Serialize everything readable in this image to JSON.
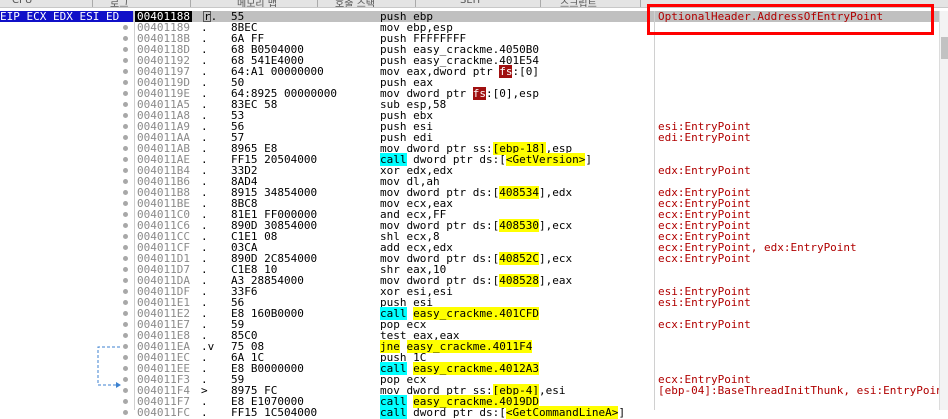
{
  "top_tabs": [
    "CPU",
    "로그",
    "메모리 맵",
    "호출 스택",
    "SEH",
    "스크립트"
  ],
  "reg_header": "EIP ECX EDX ESI ED",
  "rows": [
    {
      "addr": "00401188",
      "mark": "r.",
      "hex": "55",
      "pre": "push ebp",
      "hl": "",
      "post": "",
      "cmt": "OptionalHeader.AddressOfEntryPoint",
      "sel": true
    },
    {
      "addr": "00401189",
      "mark": ".",
      "hex": "8BEC",
      "pre": "mov ebp,esp",
      "hl": "",
      "post": "",
      "cmt": ""
    },
    {
      "addr": "0040118B",
      "mark": ".",
      "hex": "6A FF",
      "pre": "push FFFFFFFF",
      "hl": "",
      "post": "",
      "cmt": ""
    },
    {
      "addr": "0040118D",
      "mark": ".",
      "hex": "68 B0504000",
      "pre": "push easy_crackme.4050B0",
      "hl": "",
      "post": "",
      "cmt": ""
    },
    {
      "addr": "00401192",
      "mark": ".",
      "hex": "68 541E4000",
      "pre": "push easy_crackme.401E54",
      "hl": "",
      "post": "",
      "cmt": ""
    },
    {
      "addr": "00401197",
      "mark": ".",
      "hex": "64:A1 00000000",
      "pre": "mov eax,dword ptr ",
      "hl": "fs",
      "hlc": "r",
      "post": ":[0]",
      "cmt": ""
    },
    {
      "addr": "0040119D",
      "mark": ".",
      "hex": "50",
      "pre": "push eax",
      "hl": "",
      "post": "",
      "cmt": ""
    },
    {
      "addr": "0040119E",
      "mark": ".",
      "hex": "64:8925 00000000",
      "pre": "mov dword ptr ",
      "hl": "fs",
      "hlc": "r",
      "post": ":[0],esp",
      "cmt": ""
    },
    {
      "addr": "004011A5",
      "mark": ".",
      "hex": "83EC 58",
      "pre": "sub esp,58",
      "hl": "",
      "post": "",
      "cmt": ""
    },
    {
      "addr": "004011A8",
      "mark": ".",
      "hex": "53",
      "pre": "push ebx",
      "hl": "",
      "post": "",
      "cmt": ""
    },
    {
      "addr": "004011A9",
      "mark": ".",
      "hex": "56",
      "pre": "push esi",
      "hl": "",
      "post": "",
      "cmt": "esi:EntryPoint"
    },
    {
      "addr": "004011AA",
      "mark": ".",
      "hex": "57",
      "pre": "push edi",
      "hl": "",
      "post": "",
      "cmt": "edi:EntryPoint"
    },
    {
      "addr": "004011AB",
      "mark": ".",
      "hex": "8965 E8",
      "pre": "mov dword ptr ss:",
      "hl": "[ebp-18]",
      "hlc": "y",
      "post": ",esp",
      "cmt": ""
    },
    {
      "addr": "004011AE",
      "mark": ".",
      "hex": "FF15 20504000",
      "pre": "",
      "hl": "call",
      "hlc": "c",
      "post": " dword ptr ds:[<GetVersion>]",
      "post_hl": "<GetVersion>",
      "cmt": ""
    },
    {
      "addr": "004011B4",
      "mark": ".",
      "hex": "33D2",
      "pre": "xor edx,edx",
      "hl": "",
      "post": "",
      "cmt": "edx:EntryPoint"
    },
    {
      "addr": "004011B6",
      "mark": ".",
      "hex": "8AD4",
      "pre": "mov dl,ah",
      "hl": "",
      "post": "",
      "cmt": ""
    },
    {
      "addr": "004011B8",
      "mark": ".",
      "hex": "8915 34854000",
      "pre": "mov dword ptr ds:[",
      "hl": "408534",
      "hlc": "y",
      "post": "],edx",
      "cmt": "edx:EntryPoint"
    },
    {
      "addr": "004011BE",
      "mark": ".",
      "hex": "8BC8",
      "pre": "mov ecx,eax",
      "hl": "",
      "post": "",
      "cmt": "ecx:EntryPoint"
    },
    {
      "addr": "004011C0",
      "mark": ".",
      "hex": "81E1 FF000000",
      "pre": "and ecx,FF",
      "hl": "",
      "post": "",
      "cmt": "ecx:EntryPoint"
    },
    {
      "addr": "004011C6",
      "mark": ".",
      "hex": "890D 30854000",
      "pre": "mov dword ptr ds:[",
      "hl": "408530",
      "hlc": "y",
      "post": "],ecx",
      "cmt": "ecx:EntryPoint"
    },
    {
      "addr": "004011CC",
      "mark": ".",
      "hex": "C1E1 08",
      "pre": "shl ecx,8",
      "hl": "",
      "post": "",
      "cmt": "ecx:EntryPoint"
    },
    {
      "addr": "004011CF",
      "mark": ".",
      "hex": "03CA",
      "pre": "add ecx,edx",
      "hl": "",
      "post": "",
      "cmt": "ecx:EntryPoint, edx:EntryPoint"
    },
    {
      "addr": "004011D1",
      "mark": ".",
      "hex": "890D 2C854000",
      "pre": "mov dword ptr ds:[",
      "hl": "40852C",
      "hlc": "y",
      "post": "],ecx",
      "cmt": "ecx:EntryPoint"
    },
    {
      "addr": "004011D7",
      "mark": ".",
      "hex": "C1E8 10",
      "pre": "shr eax,10",
      "hl": "",
      "post": "",
      "cmt": ""
    },
    {
      "addr": "004011DA",
      "mark": ".",
      "hex": "A3 28854000",
      "pre": "mov dword ptr ds:[",
      "hl": "408528",
      "hlc": "y",
      "post": "],eax",
      "cmt": ""
    },
    {
      "addr": "004011DF",
      "mark": ".",
      "hex": "33F6",
      "pre": "xor esi,esi",
      "hl": "",
      "post": "",
      "cmt": "esi:EntryPoint"
    },
    {
      "addr": "004011E1",
      "mark": ".",
      "hex": "56",
      "pre": "push esi",
      "hl": "",
      "post": "",
      "cmt": "esi:EntryPoint"
    },
    {
      "addr": "004011E2",
      "mark": ".",
      "hex": "E8 160B0000",
      "pre": "",
      "hl": "call",
      "hlc": "c",
      "post": " easy_crackme.401CFD",
      "post_hl": "easy_crackme.401CFD",
      "cmt": ""
    },
    {
      "addr": "004011E7",
      "mark": ".",
      "hex": "59",
      "pre": "pop ecx",
      "hl": "",
      "post": "",
      "cmt": "ecx:EntryPoint"
    },
    {
      "addr": "004011E8",
      "mark": ".",
      "hex": "85C0",
      "pre": "test eax,eax",
      "hl": "",
      "post": "",
      "cmt": ""
    },
    {
      "addr": "004011EA",
      "mark": ".v",
      "hex": "75 08",
      "pre": "",
      "hl": "jne",
      "hlc": "y",
      "post": " easy_crackme.4011F4",
      "post_hl": "easy_crackme.4011F4",
      "cmt": ""
    },
    {
      "addr": "004011EC",
      "mark": ".",
      "hex": "6A 1C",
      "pre": "push 1C",
      "hl": "",
      "post": "",
      "cmt": ""
    },
    {
      "addr": "004011EE",
      "mark": ".",
      "hex": "E8 B0000000",
      "pre": "",
      "hl": "call",
      "hlc": "c",
      "post": " easy_crackme.4012A3",
      "post_hl": "easy_crackme.4012A3",
      "cmt": ""
    },
    {
      "addr": "004011F3",
      "mark": ".",
      "hex": "59",
      "pre": "pop ecx",
      "hl": "",
      "post": "",
      "cmt": "ecx:EntryPoint"
    },
    {
      "addr": "004011F4",
      "mark": ">",
      "hex": "8975 FC",
      "pre": "mov dword ptr ss:",
      "hl": "[ebp-4]",
      "hlc": "y",
      "post": ",esi",
      "cmt": "[ebp-04]:BaseThreadInitThunk, esi:EntryPoint"
    },
    {
      "addr": "004011F7",
      "mark": ".",
      "hex": "E8 E1070000",
      "pre": "",
      "hl": "call",
      "hlc": "c",
      "post": " easy_crackme.4019DD",
      "post_hl": "easy_crackme.4019DD",
      "cmt": ""
    },
    {
      "addr": "004011FC",
      "mark": ".",
      "hex": "FF15 1C504000",
      "pre": "",
      "hl": "call",
      "hlc": "c",
      "post": " dword ptr ds:[<GetCommandLineA>]",
      "post_hl": "<GetCommandLineA>",
      "cmt": ""
    }
  ],
  "colors": {
    "selection": "#1010c8",
    "comment": "#b00000",
    "highlight_yellow": "#ffff00",
    "highlight_cyan": "#00ffff",
    "callout": "#ff0000"
  }
}
